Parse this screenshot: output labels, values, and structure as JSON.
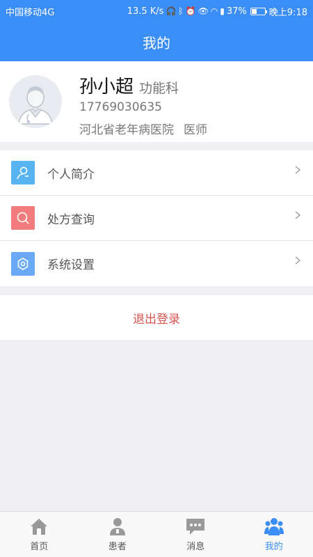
{
  "status_bar": {
    "carrier": "中国移动4G",
    "speed": "13.5 K/s",
    "battery": "37%",
    "battery_fraction": 0.37,
    "time": "晚上9:18"
  },
  "header": {
    "title": "我的"
  },
  "profile": {
    "name": "孙小超",
    "department": "功能科",
    "phone": "17769030635",
    "hospital": "河北省老年病医院",
    "role": "医师"
  },
  "menu": [
    {
      "label": "个人简介",
      "icon": "profile-icon",
      "color": "#58b4f0"
    },
    {
      "label": "处方查询",
      "icon": "search-icon",
      "color": "#f27b7b"
    },
    {
      "label": "系统设置",
      "icon": "settings-icon",
      "color": "#6aa9f5"
    }
  ],
  "logout": {
    "label": "退出登录"
  },
  "tabs": [
    {
      "label": "首页",
      "icon": "home-icon"
    },
    {
      "label": "患者",
      "icon": "patient-icon"
    },
    {
      "label": "消息",
      "icon": "message-icon"
    },
    {
      "label": "我的",
      "icon": "mine-icon",
      "active": true
    }
  ],
  "colors": {
    "primary": "#3b8ef5",
    "logout": "#d9534f",
    "background": "#efeff4"
  }
}
